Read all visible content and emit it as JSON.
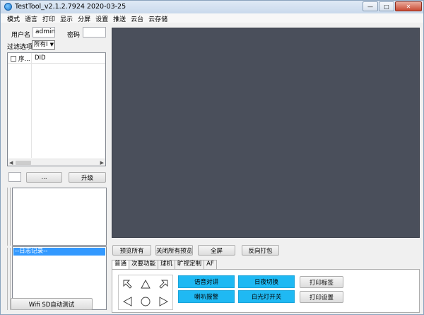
{
  "window": {
    "title": "TestTool_v2.1.2.7924 2020-03-25",
    "controls": {
      "minimize": "—",
      "maximize": "□",
      "close": "✕"
    }
  },
  "menu": [
    "模式",
    "语言",
    "打印",
    "显示",
    "分屏",
    "设置",
    "推送",
    "云台",
    "云存储"
  ],
  "login": {
    "username_label": "用户名",
    "username_value": "admin",
    "password_label": "密码",
    "password_value": ""
  },
  "filter": {
    "label": "过滤选项",
    "selected": "所有I"
  },
  "device_list": {
    "columns": [
      "序...",
      "DID"
    ],
    "rows": []
  },
  "actions": {
    "browse_label": "...",
    "upgrade_label": "升级"
  },
  "records": {
    "items": [
      "--日志记录--"
    ]
  },
  "preview_buttons": [
    "预览所有",
    "关闭所有预览",
    "全屏",
    "反向打包"
  ],
  "tabs": [
    "普通",
    "次要功能",
    "球机",
    "旷视定制",
    "AF"
  ],
  "active_tab": 0,
  "function_buttons": {
    "col1": [
      "语音对讲",
      "喇叭报警"
    ],
    "col2": [
      "日夜切换",
      "白光灯开关"
    ],
    "col3": [
      "打印标签",
      "打印设置"
    ]
  },
  "bottom_button": "Wifi SD自动测试",
  "icons": {
    "app": "app-icon",
    "direction": [
      "arrow-up-left-icon",
      "arrow-up-icon",
      "arrow-up-right-icon",
      "arrow-left-icon",
      "circle-center-icon",
      "arrow-right-icon"
    ]
  },
  "colors": {
    "video_bg": "#4a4f5b",
    "accent_button": "#1fb9f3",
    "selection": "#3399ff"
  }
}
